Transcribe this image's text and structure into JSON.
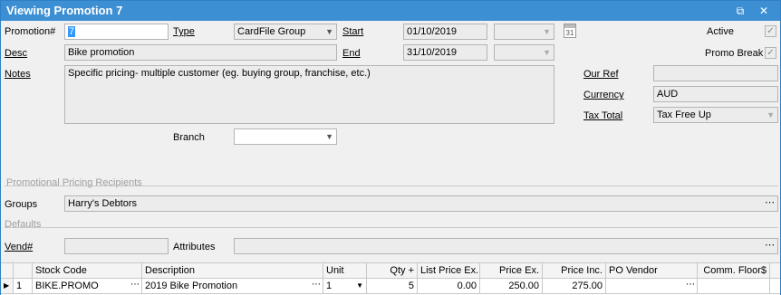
{
  "window": {
    "title": "Viewing Promotion 7"
  },
  "form": {
    "promotion_label": "Promotion#",
    "promotion_value": "7",
    "type_label": "Type",
    "type_value": "CardFile Group",
    "start_label": "Start",
    "start_value": "01/10/2019",
    "calendar_day": "31",
    "active_label": "Active",
    "active_checked": true,
    "desc_label": "Desc",
    "desc_value": "Bike promotion",
    "end_label": "End",
    "end_value": "31/10/2019",
    "promo_break_label": "Promo Break",
    "promo_break_checked": true,
    "notes_label": "Notes",
    "notes_value": "Specific pricing- multiple customer (eg. buying group, franchise, etc.)",
    "our_ref_label": "Our Ref",
    "our_ref_value": "",
    "currency_label": "Currency",
    "currency_value": "AUD",
    "tax_total_label": "Tax Total",
    "tax_total_value": "Tax Free Up",
    "branch_label": "Branch",
    "branch_value": ""
  },
  "recipients": {
    "section_title": "Promotional Pricing Recipients",
    "groups_label": "Groups",
    "groups_value": "Harry's Debtors"
  },
  "defaults": {
    "section_title": "Defaults",
    "vend_label": "Vend#",
    "vend_value": "",
    "attributes_label": "Attributes",
    "attributes_value": ""
  },
  "grid": {
    "headers": {
      "stock_code": "Stock Code",
      "description": "Description",
      "unit": "Unit",
      "qty": "Qty +",
      "list_price": "List Price Ex.",
      "price_ex": "Price Ex.",
      "price_inc": "Price Inc.",
      "po_vendor": "PO Vendor",
      "comm_floor": "Comm. Floor$"
    },
    "rows": [
      {
        "num": "1",
        "stock_code": "BIKE.PROMO",
        "description": "2019 Bike Promotion",
        "unit": "1",
        "qty": "5",
        "list_price": "0.00",
        "price_ex": "250.00",
        "price_inc": "275.00",
        "po_vendor": "",
        "comm_floor": ""
      }
    ]
  },
  "icons": {
    "restore": "restore-icon",
    "close": "close-icon",
    "calendar": "calendar-icon",
    "ellipsis": "ellipsis-icon",
    "dropdown": "chevron-down-icon"
  },
  "colors": {
    "titlebar": "#3d8fd3",
    "selection": "#3399ff"
  }
}
